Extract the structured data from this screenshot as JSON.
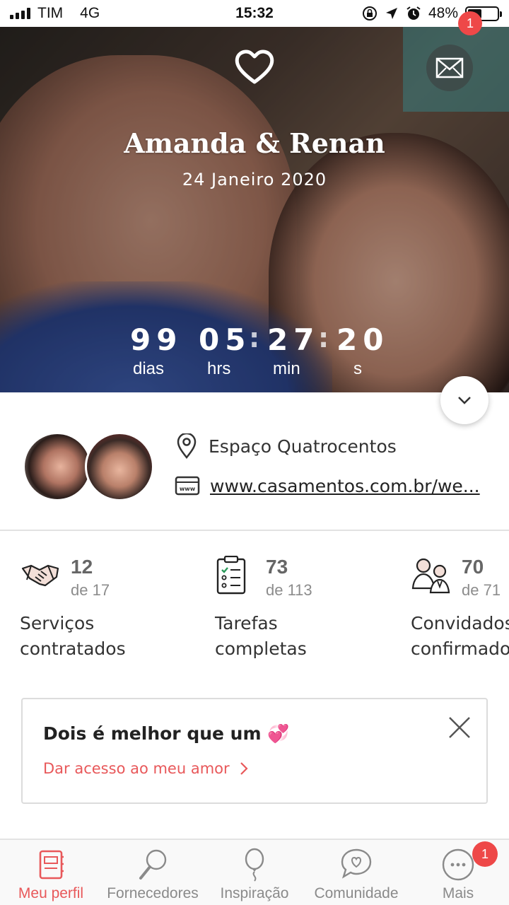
{
  "status_bar": {
    "carrier": "TIM",
    "network": "4G",
    "time": "15:32",
    "battery": "48%",
    "battery_level": 0.48
  },
  "hero": {
    "couple_name": "Amanda & Renan",
    "wedding_date": "24 Janeiro 2020",
    "mail_badge": "1",
    "countdown": {
      "days": "99",
      "hours": "05",
      "minutes": "27",
      "seconds": "20",
      "days_label": "dias",
      "hours_label": "hrs",
      "minutes_label": "min",
      "seconds_label": "s"
    }
  },
  "profile": {
    "venue": "Espaço Quatrocentos",
    "website": "www.casamentos.com.br/we..."
  },
  "stats": [
    {
      "value": "12",
      "of": "de 17",
      "label_line1": "Serviços",
      "label_line2": "contratados",
      "icon": "handshake-icon"
    },
    {
      "value": "73",
      "of": "de 113",
      "label_line1": "Tarefas",
      "label_line2": "completas",
      "icon": "checklist-icon"
    },
    {
      "value": "70",
      "of": "de 71",
      "label_line1": "Convidados",
      "label_line2": "confirmados",
      "icon": "guests-icon"
    }
  ],
  "card": {
    "title": "Dois é melhor que um 💞",
    "link": "Dar acesso ao meu amor"
  },
  "bottom_nav": {
    "items": [
      {
        "label": "Meu perfil",
        "icon": "notebook-icon"
      },
      {
        "label": "Fornecedores",
        "icon": "magnifier-icon"
      },
      {
        "label": "Inspiração",
        "icon": "balloon-icon"
      },
      {
        "label": "Comunidade",
        "icon": "chat-heart-icon"
      },
      {
        "label": "Mais",
        "icon": "more-icon"
      }
    ],
    "more_badge": "1"
  },
  "colors": {
    "accent": "#e8585a",
    "badge": "#ee4848"
  }
}
